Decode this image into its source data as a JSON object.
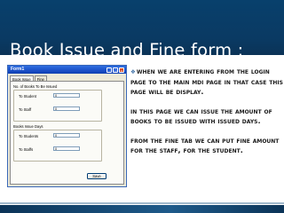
{
  "slide": {
    "title": "Book Issue and Fine form :",
    "colors": {
      "header_background": "#0a3a63",
      "title_text": "#ffffff",
      "body_text": "#1a1a1a",
      "bullet": "#3b6ea5"
    }
  },
  "window": {
    "title": "Form1",
    "controls": {
      "minimize": "_",
      "maximize": "□",
      "close": "×"
    },
    "tabs": [
      {
        "label": "Book Issue",
        "active": true
      },
      {
        "label": "Fine",
        "active": false
      }
    ],
    "group_books": {
      "label": "No. of Books To Be Issued",
      "rows": [
        {
          "label": "To Student",
          "value": "0"
        },
        {
          "label": "To Staff",
          "value": "0"
        }
      ]
    },
    "group_days": {
      "label": "Books Issue Days",
      "rows": [
        {
          "label": "To Students",
          "value": "0"
        },
        {
          "label": "To Staffs",
          "value": "0"
        }
      ]
    },
    "save_label": "Save"
  },
  "description": {
    "bullet_icon": "diamond-arrow-bullet",
    "paragraphs": [
      "When we are entering from the login page to the main MDI page in that case this page will be display.",
      "In this page we can issue the amount of books to be issued with issued days.",
      "From the fine tab we can put fine amount for the staff, for the student."
    ]
  }
}
